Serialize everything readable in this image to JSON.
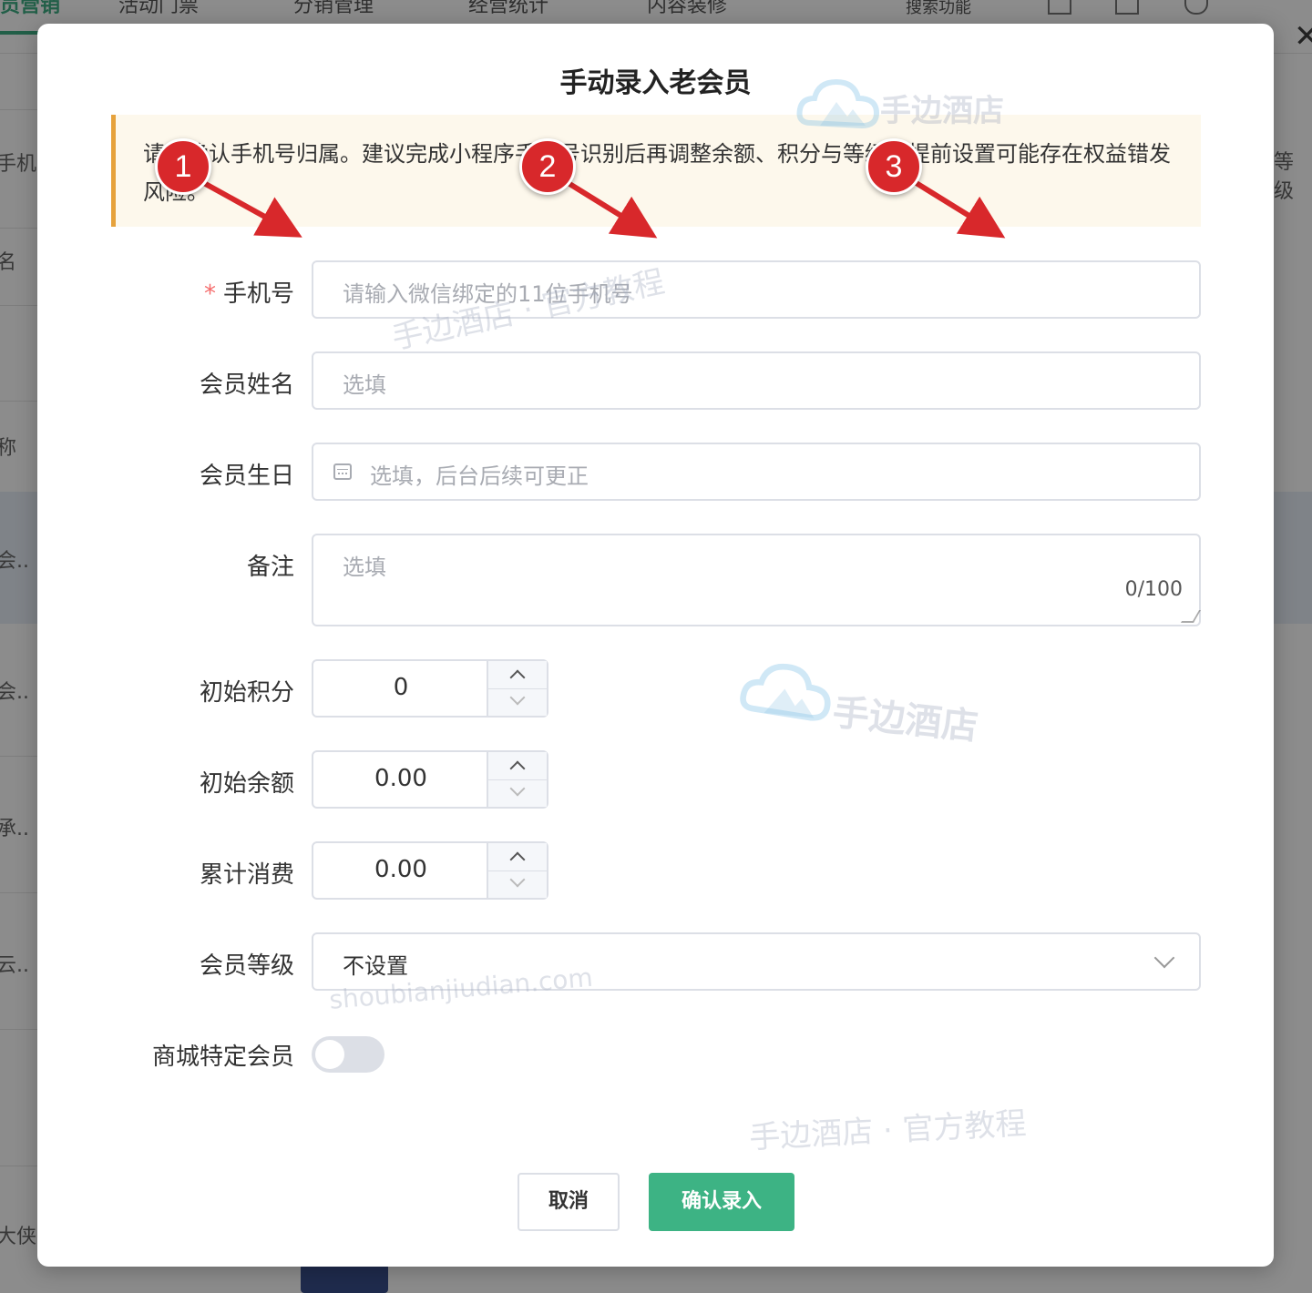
{
  "background": {
    "nav_tabs": [
      "员营销",
      "活动门票",
      "分销管理",
      "经营统计",
      "内容装修",
      "搜索功能"
    ],
    "left_texts": [
      "手机",
      "名",
      "称",
      "会..",
      "会..",
      "承..",
      "云..",
      "大侠"
    ],
    "right_text": "等级"
  },
  "modal": {
    "title": "手动录入老会员",
    "notice": "请先确认手机号归属。建议完成小程序手机号识别后再调整余额、积分与等级；提前设置可能存在权益错发风险。",
    "fields": {
      "phone": {
        "label": "手机号",
        "required_mark": "*",
        "placeholder": "请输入微信绑定的11位手机号"
      },
      "name": {
        "label": "会员姓名",
        "placeholder": "选填"
      },
      "birthday": {
        "label": "会员生日",
        "placeholder": "选填，后台后续可更正"
      },
      "remark": {
        "label": "备注",
        "placeholder": "选填",
        "counter": "0/100"
      },
      "points": {
        "label": "初始积分",
        "value": "0"
      },
      "balance": {
        "label": "初始余额",
        "value": "0.00"
      },
      "total_spend": {
        "label": "累计消费",
        "value": "0.00"
      },
      "level": {
        "label": "会员等级",
        "value": "不设置"
      },
      "mall_member": {
        "label": "商城特定会员",
        "enabled": false
      }
    },
    "buttons": {
      "cancel": "取消",
      "confirm": "确认录入"
    }
  },
  "annotations": [
    "1",
    "2",
    "3"
  ],
  "watermarks": {
    "brand": "手边酒店",
    "tutorial": "手边酒店 · 官方教程",
    "domain": "shoubianjiudian.com"
  },
  "colors": {
    "accent": "#3db384",
    "warning_border": "#e6a23c",
    "marker": "#d8282b",
    "required": "#f56c6c"
  }
}
